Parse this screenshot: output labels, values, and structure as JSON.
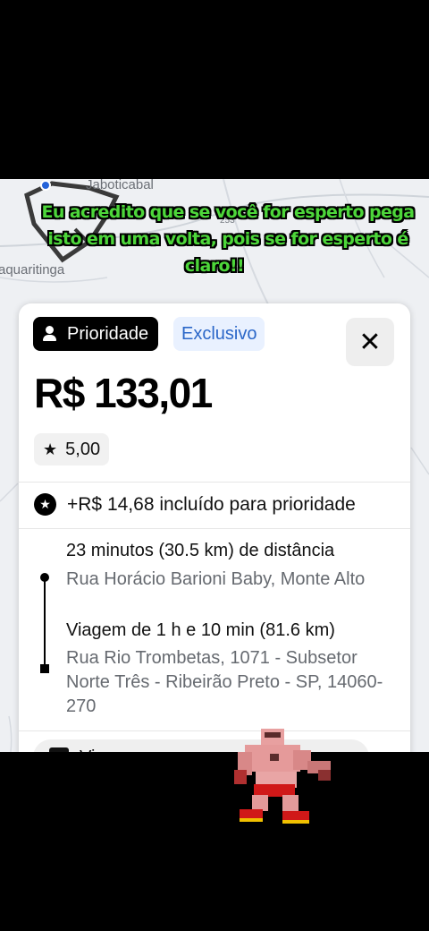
{
  "map": {
    "city_top": "Jaboticabal",
    "city_left": "aquaritinga",
    "road_number": "253"
  },
  "caption": {
    "line1": "Eu acredito que se você for esperto pega",
    "line2": "isto em uma volta, pois se for esperto é",
    "line3": "claro!!"
  },
  "ride_card": {
    "priority_label": "Prioridade",
    "exclusive_label": "Exclusivo",
    "close_symbol": "✕",
    "price": "R$ 133,01",
    "rating": "5,00",
    "priority_extra": "+R$ 14,68 incluído para prioridade",
    "pickup_eta": "23 minutos (30.5 km) de distância",
    "pickup_address": "Rua Horácio Barioni Baby, Monte Alto",
    "trip_duration": "Viagem de 1 h e 10 min (81.6 km)",
    "dropoff_address": "Rua Rio Trombetas, 1071 - Subsetor Norte Três - Ribeirão Preto - SP, 14060-270",
    "bottom_partial": "Vi"
  },
  "icons": {
    "person": "person-icon",
    "star": "star-icon",
    "star_badge": "star-circle-icon",
    "close": "close-icon"
  },
  "colors": {
    "caption_green": "#4dd63a",
    "exclusive_blue": "#2b67c8",
    "route_blue": "#2563d9"
  }
}
